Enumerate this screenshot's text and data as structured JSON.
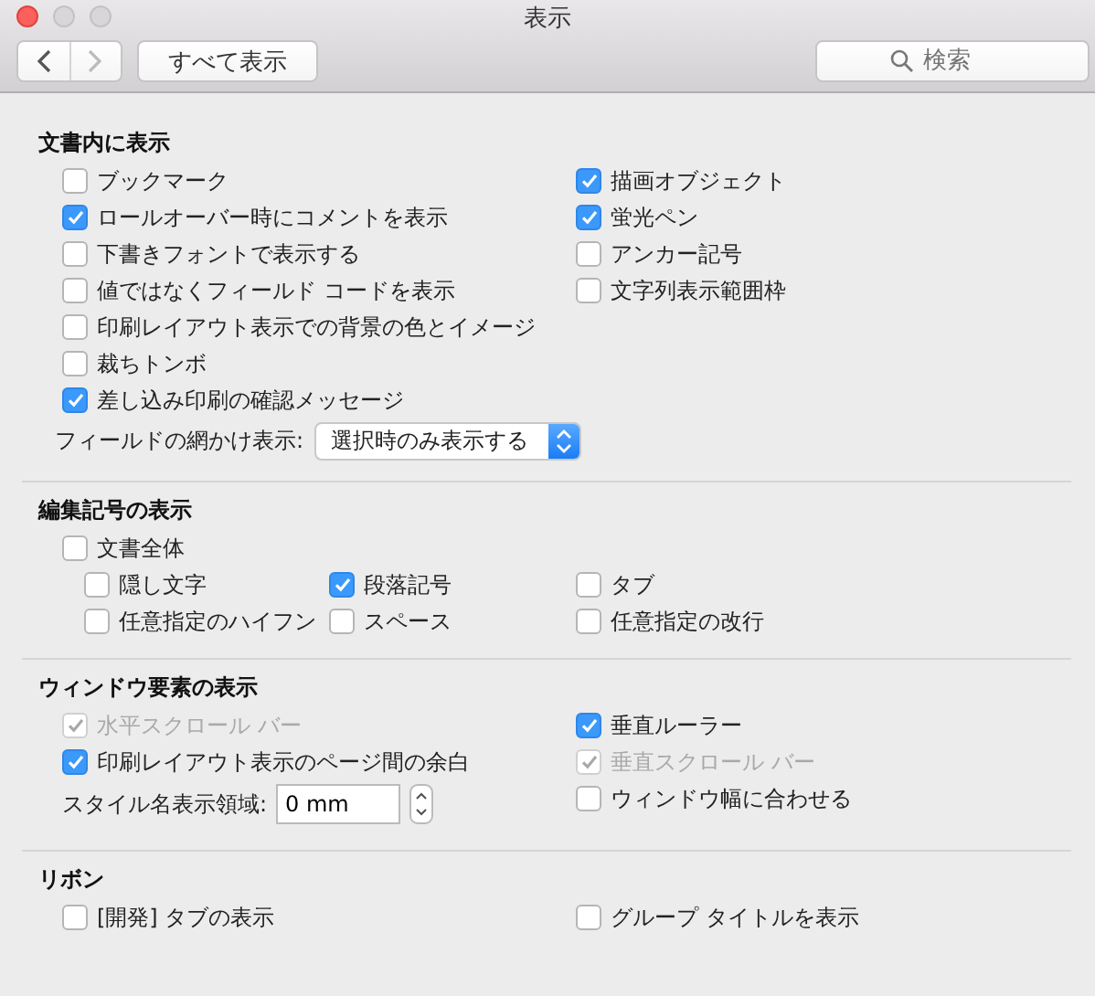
{
  "window": {
    "title": "表示"
  },
  "toolbar": {
    "back_disabled": false,
    "forward_disabled": true,
    "show_all": "すべて表示",
    "search": {
      "placeholder": "検索"
    }
  },
  "sections": [
    {
      "title": "文書内に表示",
      "columns": [
        [
          {
            "kind": "checkbox",
            "label": "ブックマーク",
            "checked": false,
            "disabled": false
          },
          {
            "kind": "checkbox",
            "label": "ロールオーバー時にコメントを表示",
            "checked": true,
            "disabled": false
          },
          {
            "kind": "checkbox",
            "label": "下書きフォントで表示する",
            "checked": false,
            "disabled": false
          },
          {
            "kind": "checkbox",
            "label": "値ではなくフィールド コードを表示",
            "checked": false,
            "disabled": false
          },
          {
            "kind": "checkbox",
            "label": "印刷レイアウト表示での背景の色とイメージ",
            "checked": false,
            "disabled": false
          },
          {
            "kind": "checkbox",
            "label": "裁ちトンボ",
            "checked": false,
            "disabled": false
          },
          {
            "kind": "checkbox",
            "label": "差し込み印刷の確認メッセージ",
            "checked": true,
            "disabled": false
          }
        ],
        [
          {
            "kind": "checkbox",
            "label": "描画オブジェクト",
            "checked": true,
            "disabled": false
          },
          {
            "kind": "checkbox",
            "label": "蛍光ペン",
            "checked": true,
            "disabled": false
          },
          {
            "kind": "checkbox",
            "label": "アンカー記号",
            "checked": false,
            "disabled": false
          },
          {
            "kind": "checkbox",
            "label": "文字列表示範囲枠",
            "checked": false,
            "disabled": false
          }
        ]
      ],
      "footer": {
        "kind": "popup",
        "label": "フィールドの網かけ表示:",
        "value": "選択時のみ表示する"
      }
    },
    {
      "title": "編集記号の表示",
      "lead": {
        "kind": "checkbox",
        "label": "文書全体",
        "checked": false,
        "disabled": false
      },
      "columns": [
        [
          {
            "kind": "checkbox",
            "label": "隠し文字",
            "checked": false,
            "disabled": false
          },
          {
            "kind": "checkbox",
            "label": "任意指定のハイフン",
            "checked": false,
            "disabled": false
          }
        ],
        [
          {
            "kind": "checkbox",
            "label": "段落記号",
            "checked": true,
            "disabled": false
          },
          {
            "kind": "checkbox",
            "label": "スペース",
            "checked": false,
            "disabled": false
          }
        ],
        [
          {
            "kind": "checkbox",
            "label": "タブ",
            "checked": false,
            "disabled": false
          },
          {
            "kind": "checkbox",
            "label": "任意指定の改行",
            "checked": false,
            "disabled": false
          }
        ]
      ]
    },
    {
      "title": "ウィンドウ要素の表示",
      "columns": [
        [
          {
            "kind": "checkbox",
            "label": "水平スクロール バー",
            "checked": true,
            "disabled": true
          },
          {
            "kind": "checkbox",
            "label": "印刷レイアウト表示のページ間の余白",
            "checked": true,
            "disabled": false
          },
          {
            "kind": "stepper",
            "label": "スタイル名表示領域:",
            "value": "0 mm"
          }
        ],
        [
          {
            "kind": "checkbox",
            "label": "垂直ルーラー",
            "checked": true,
            "disabled": false
          },
          {
            "kind": "checkbox",
            "label": "垂直スクロール バー",
            "checked": true,
            "disabled": true
          },
          {
            "kind": "checkbox",
            "label": "ウィンドウ幅に合わせる",
            "checked": false,
            "disabled": false
          }
        ]
      ]
    },
    {
      "title": "リボン",
      "columns": [
        [
          {
            "kind": "checkbox",
            "label": "[開発] タブの表示",
            "checked": false,
            "disabled": false
          }
        ],
        [
          {
            "kind": "checkbox",
            "label": "グループ タイトルを表示",
            "checked": false,
            "disabled": false
          }
        ]
      ]
    }
  ]
}
